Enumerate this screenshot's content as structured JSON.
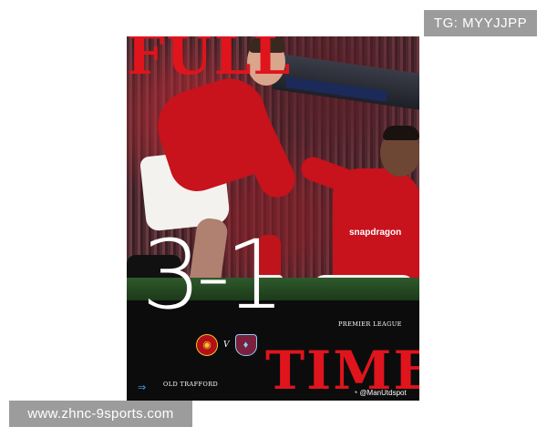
{
  "overlay": {
    "tg_label": "TG: MYYJJPP",
    "site_url": "www.zhnc-9sports.com"
  },
  "poster": {
    "title_top": "FULL",
    "title_bottom": "TIME",
    "score": "3-1",
    "competition": "PREMIER LEAGUE",
    "versus": "V",
    "venue": "OLD TRAFFORD",
    "social_handle": "@ManUtdspot",
    "sponsor": "snapdragon",
    "icons": {
      "home_crest": "manchester-united-crest-icon",
      "away_crest": "aston-villa-crest-icon",
      "exit": "exit-icon",
      "weibo": "weibo-icon"
    },
    "colors": {
      "accent_red": "#e0141c",
      "panel": "#0c0c0c",
      "badge_gray": "#9c9c9c"
    }
  }
}
